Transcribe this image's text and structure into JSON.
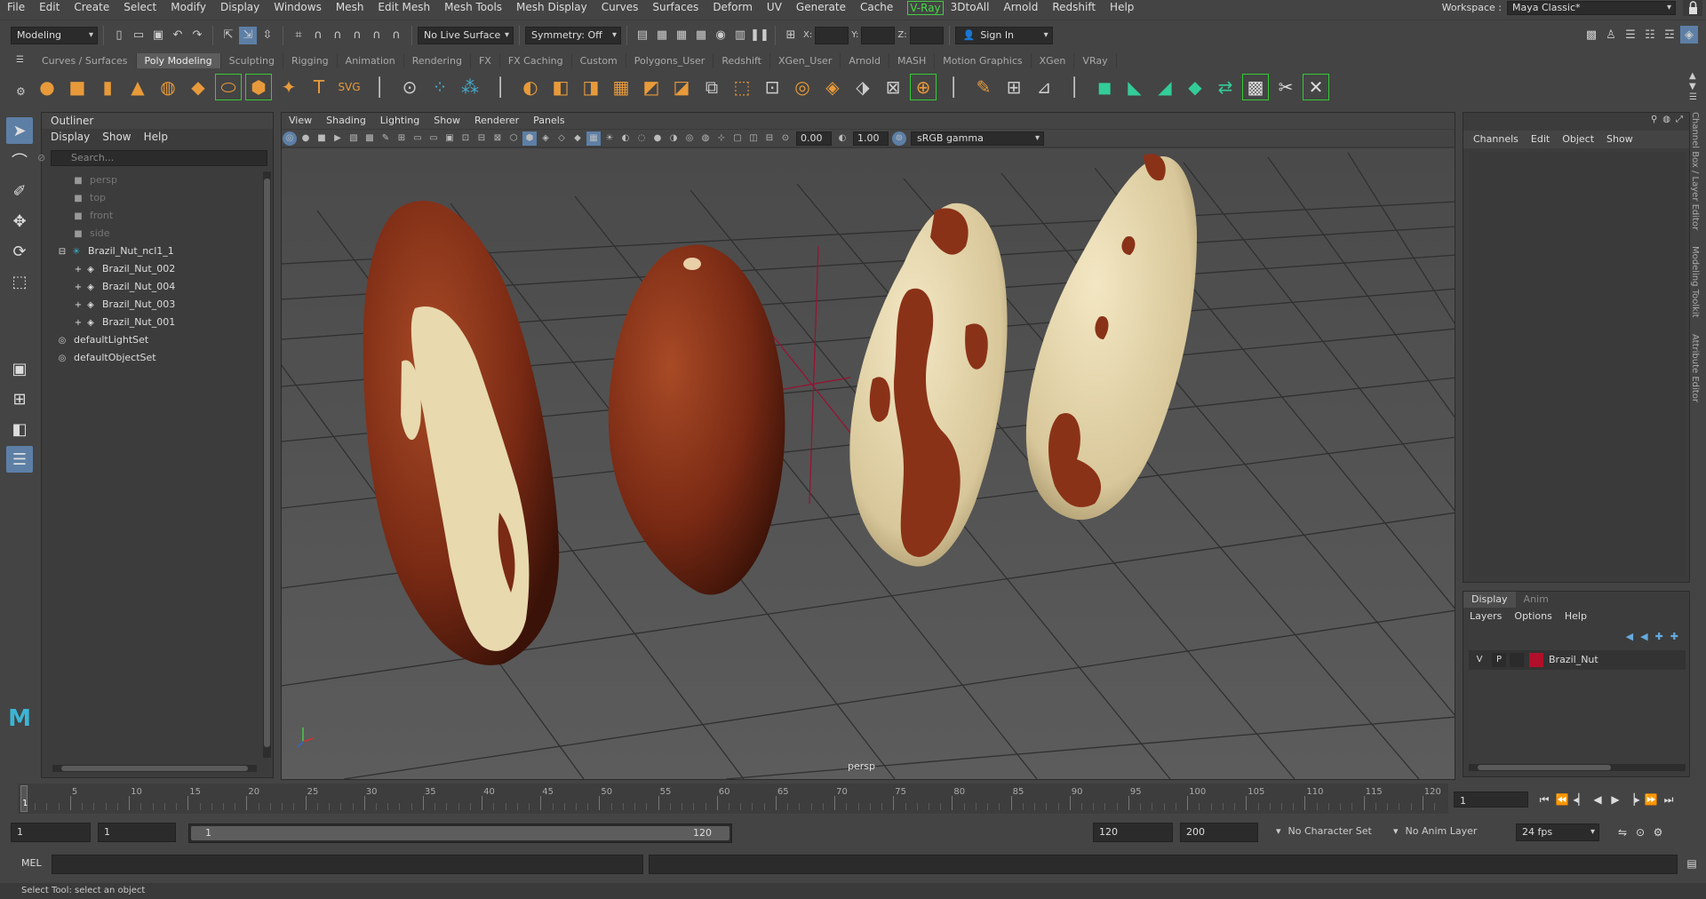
{
  "menubar": {
    "items": [
      "File",
      "Edit",
      "Create",
      "Select",
      "Modify",
      "Display",
      "Windows",
      "Mesh",
      "Edit Mesh",
      "Mesh Tools",
      "Mesh Display",
      "Curves",
      "Surfaces",
      "Deform",
      "UV",
      "Generate",
      "Cache"
    ],
    "vray": "V-Ray",
    "items2": [
      "3DtoAll",
      "Arnold",
      "Redshift",
      "Help"
    ],
    "workspace_label": "Workspace :",
    "workspace_value": "Maya Classic*"
  },
  "statusline": {
    "mode": "Modeling",
    "live_surface": "No Live Surface",
    "symmetry": "Symmetry: Off",
    "x_label": "X:",
    "y_label": "Y:",
    "z_label": "Z:",
    "sign_in": "Sign In"
  },
  "shelf": {
    "tabs": [
      "Curves / Surfaces",
      "Poly Modeling",
      "Sculpting",
      "Rigging",
      "Animation",
      "Rendering",
      "FX",
      "FX Caching",
      "Custom",
      "Polygons_User",
      "Redshift",
      "XGen_User",
      "Arnold",
      "MASH",
      "Motion Graphics",
      "XGen",
      "VRay"
    ],
    "active_tab": "Poly Modeling"
  },
  "outliner": {
    "title": "Outliner",
    "menu": [
      "Display",
      "Show",
      "Help"
    ],
    "search_placeholder": "Search...",
    "items": [
      {
        "label": "persp",
        "dim": true,
        "indent": 1,
        "icon": "camera-icon"
      },
      {
        "label": "top",
        "dim": true,
        "indent": 1,
        "icon": "camera-icon"
      },
      {
        "label": "front",
        "dim": true,
        "indent": 1,
        "icon": "camera-icon"
      },
      {
        "label": "side",
        "dim": true,
        "indent": 1,
        "icon": "camera-icon"
      },
      {
        "label": "Brazil_Nut_ncl1_1",
        "dim": false,
        "indent": 0,
        "icon": "group-icon"
      },
      {
        "label": "Brazil_Nut_002",
        "dim": false,
        "indent": 1,
        "icon": "mesh-icon"
      },
      {
        "label": "Brazil_Nut_004",
        "dim": false,
        "indent": 1,
        "icon": "mesh-icon"
      },
      {
        "label": "Brazil_Nut_003",
        "dim": false,
        "indent": 1,
        "icon": "mesh-icon"
      },
      {
        "label": "Brazil_Nut_001",
        "dim": false,
        "indent": 1,
        "icon": "mesh-icon"
      },
      {
        "label": "defaultLightSet",
        "dim": false,
        "indent": 0,
        "icon": "set-icon"
      },
      {
        "label": "defaultObjectSet",
        "dim": false,
        "indent": 0,
        "icon": "set-icon"
      }
    ]
  },
  "viewport": {
    "menu": [
      "View",
      "Shading",
      "Lighting",
      "Show",
      "Renderer",
      "Panels"
    ],
    "exposure": "0.00",
    "gamma": "1.00",
    "color_space": "sRGB gamma",
    "camera_label": "persp"
  },
  "channelbox": {
    "menu": [
      "Channels",
      "Edit",
      "Object",
      "Show"
    ]
  },
  "layers": {
    "tabs": [
      "Display",
      "Anim"
    ],
    "active_tab": "Display",
    "menu": [
      "Layers",
      "Options",
      "Help"
    ],
    "layer": {
      "v": "V",
      "p": "P",
      "name": "Brazil_Nut",
      "color": "#b0102a"
    }
  },
  "side_tabs": [
    "Channel Box / Layer Editor",
    "Modeling Toolkit",
    "Attribute Editor"
  ],
  "timeline": {
    "labels": [
      "5",
      "10",
      "15",
      "20",
      "25",
      "30",
      "35",
      "40",
      "45",
      "50",
      "55",
      "60",
      "65",
      "70",
      "75",
      "80",
      "85",
      "90",
      "95",
      "100",
      "105",
      "110",
      "115",
      "120"
    ],
    "current_frame_marker": "1",
    "current_frame": "1"
  },
  "range": {
    "start": "1",
    "anim_start": "1",
    "slider_start": "1",
    "slider_end": "120",
    "end": "120",
    "anim_end": "200",
    "character_set": "No Character Set",
    "anim_layer": "No Anim Layer",
    "fps": "24 fps"
  },
  "cmdline": {
    "label": "MEL"
  },
  "helpline": {
    "text": "Select Tool: select an object"
  },
  "colors": {
    "accent": "#5d7fa6",
    "vray": "#44dd44",
    "nut_dark": "#7a2a14",
    "nut_light": "#e8d9ae"
  }
}
